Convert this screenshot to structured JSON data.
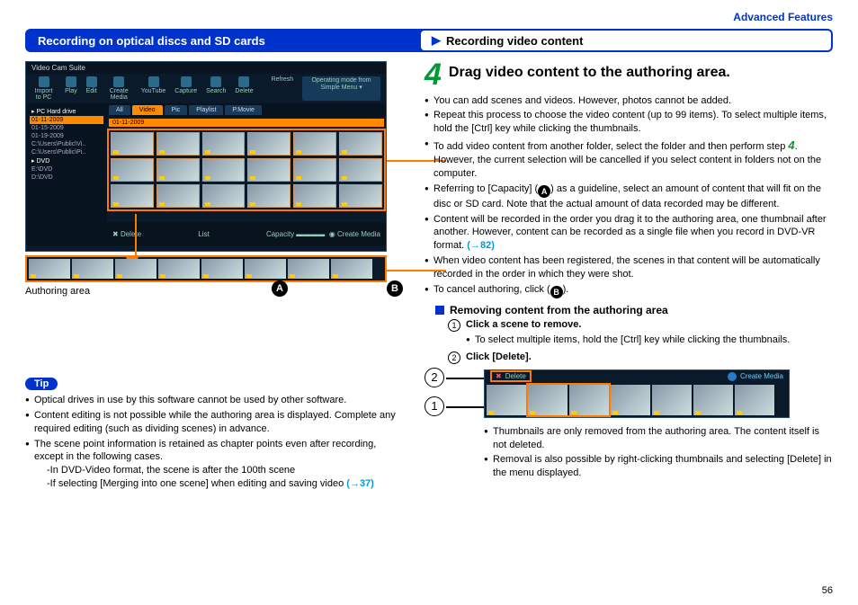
{
  "header": {
    "section_link": "Advanced Features"
  },
  "bar": {
    "left": "Recording on optical discs and SD cards",
    "right": "Recording video content"
  },
  "app": {
    "title": "Video Cam Suite",
    "toolbar": [
      "Import to PC",
      "Play",
      "Edit",
      "Create Media",
      "YouTube",
      "Capture",
      "Search",
      "Delete"
    ],
    "refresh": "Refresh",
    "mode_label": "Operating mode from",
    "mode_value": "Simple Menu",
    "sidebar": {
      "root": "PC Hard drive",
      "dates": [
        "01-11-2009",
        "01-15-2009",
        "01-19-2009"
      ],
      "folders": [
        "C:\\Users\\Public\\Vi..",
        "C:\\Users\\Public\\Pi.."
      ],
      "dvd": "DVD",
      "drives": [
        "E:\\DVD",
        "D:\\DVD"
      ]
    },
    "tabs": [
      "All",
      "Video",
      "Pic",
      "Playlist",
      "P.Movie"
    ],
    "grid_date": "01-11-2009",
    "footer_left": "Delete",
    "footer_center": "List",
    "footer_right_cap": "Capacity",
    "footer_right_cm": "Create Media"
  },
  "left": {
    "authoring_label": "Authoring area",
    "marker_a": "A",
    "marker_b": "B",
    "tip_label": "Tip",
    "tips": [
      "Optical drives in use by this software cannot be used by other software.",
      "Content editing is not possible while the authoring area is displayed. Complete any required editing (such as dividing scenes) in advance.",
      "The scene point information is retained as chapter points even after recording, except in the following cases."
    ],
    "tip_sub1": "-In DVD-Video format, the scene is after the 100th scene",
    "tip_sub2": "-If selecting [Merging into one scene] when editing and saving video",
    "tip_link": "(→37)"
  },
  "right": {
    "step_number": "4",
    "step_title": "Drag video content to the authoring area.",
    "bullets": {
      "b1": "You can add scenes and videos. However, photos cannot be added.",
      "b2": "Repeat this process to choose the video content (up to 99 items). To select multiple items, hold the [Ctrl] key while clicking the thumbnails.",
      "b3a": "To add video content from another folder, select the folder and then perform step ",
      "b3step": "4",
      "b3b": ". However, the current selection will be cancelled if you select content in folders not on the computer.",
      "b4a": "Referring to [Capacity] (",
      "b4b": ") as a guideline, select an amount of content that will fit on the disc or SD card. Note that the actual amount of data recorded may be different.",
      "b5": "Content will be recorded in the order you drag it to the authoring area, one thumbnail after another. However, content can be recorded as a single file when you record in DVD-VR format.",
      "b5link": "(→82)",
      "b6": "When video content has been registered, the scenes in that content will be automatically recorded in the order in which they were shot.",
      "b7a": "To cancel authoring, click (",
      "b7b": ")."
    },
    "remove": {
      "heading": "Removing content from the authoring area",
      "step1": "Click a scene to remove.",
      "step1_note": "To select multiple items, hold the [Ctrl] key while clicking the thumbnails.",
      "step2": "Click [Delete].",
      "shot_delete": "Delete",
      "shot_cm": "Create Media",
      "after1": "Thumbnails are only removed from the authoring area. The content itself is not deleted.",
      "after2": "Removal is also possible by right-clicking thumbnails and selecting [Delete] in the menu displayed."
    }
  },
  "page_number": "56"
}
